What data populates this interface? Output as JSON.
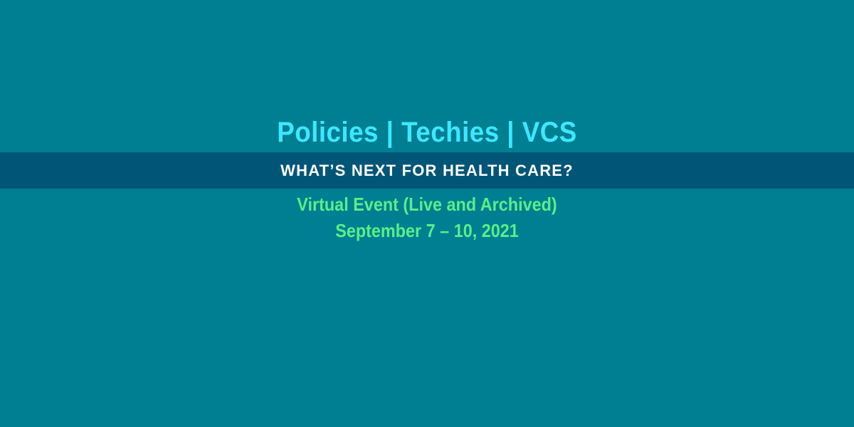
{
  "banner": {
    "headline": "Policies | Techies | VCS",
    "tagline": "WHAT’S NEXT FOR HEALTH CARE?",
    "event_type": "Virtual Event (Live and Archived)",
    "dates": "September 7 – 10, 2021"
  },
  "colors": {
    "background": "#007e92",
    "stripe": "#015677",
    "headline": "#3be8ff",
    "tagline": "#ffffff",
    "details": "#58f087"
  }
}
